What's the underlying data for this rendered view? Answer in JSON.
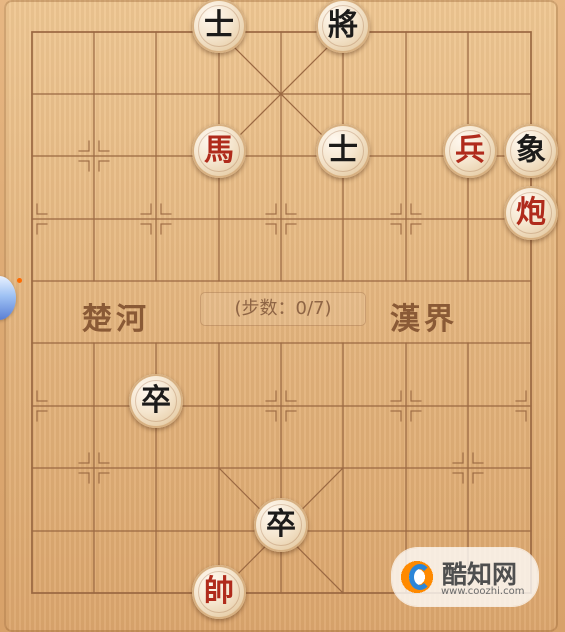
{
  "board": {
    "river_left": "楚河",
    "river_right": "漢界",
    "step_counter": "(步数：0/7)"
  },
  "pieces": {
    "black_shi_top": "士",
    "black_jiang": "將",
    "red_ma": "馬",
    "black_shi_mid": "士",
    "red_bing": "兵",
    "black_xiang": "象",
    "red_pao": "炮",
    "black_zu_left": "卒",
    "black_zu_center": "卒",
    "red_shuai": "帥"
  },
  "watermark": {
    "title": "酷知网",
    "url": "www.coozhi.com"
  },
  "colors": {
    "black_piece_text": "#1c1b1a",
    "red_piece_text": "#b02b1c",
    "board_line": "#9a6842"
  }
}
